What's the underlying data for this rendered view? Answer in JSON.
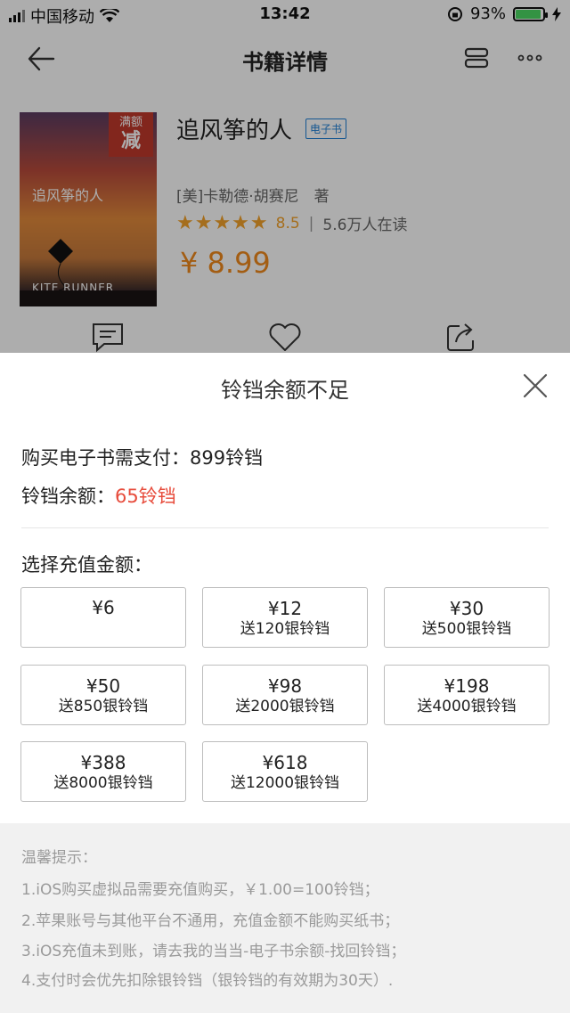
{
  "status_bar": {
    "carrier": "中国移动",
    "time": "13:42",
    "battery": "93%"
  },
  "nav": {
    "title": "书籍详情"
  },
  "book": {
    "title": "追风筝的人",
    "tag": "电子书",
    "author": "[美]卡勒德·胡赛尼　著",
    "rating": "8.5",
    "readers": "5.6万人在读",
    "price": "¥ 8.99",
    "cover": {
      "badge_top": "满额",
      "badge_big": "减",
      "cn_title": "追风筝的人",
      "en_title": "KITE RUNNER"
    }
  },
  "modal": {
    "title": "铃铛余额不足",
    "pay_label": "购买电子书需支付：",
    "pay_amount": "899铃铛",
    "balance_label": "铃铛余额：",
    "balance_amount": "65铃铛",
    "choose_label": "选择充值金额：",
    "options": [
      {
        "amount": "¥6",
        "bonus": ""
      },
      {
        "amount": "¥12",
        "bonus": "送120银铃铛"
      },
      {
        "amount": "¥30",
        "bonus": "送500银铃铛"
      },
      {
        "amount": "¥50",
        "bonus": "送850银铃铛"
      },
      {
        "amount": "¥98",
        "bonus": "送2000银铃铛"
      },
      {
        "amount": "¥198",
        "bonus": "送4000银铃铛"
      },
      {
        "amount": "¥388",
        "bonus": "送8000银铃铛"
      },
      {
        "amount": "¥618",
        "bonus": "送12000银铃铛"
      }
    ]
  },
  "tips": {
    "heading": "温馨提示：",
    "items": [
      "1.iOS购买虚拟品需要充值购买，￥1.00=100铃铛；",
      "2.苹果账号与其他平台不通用，充值金额不能购买纸书；",
      "3.iOS充值未到账，请去我的当当-电子书余额-找回铃铛；",
      "4.支付时会优先扣除银铃铛（银铃铛的有效期为30天）."
    ]
  },
  "colors": {
    "price_orange": "#f08a1c",
    "star_gold": "#f3a32b",
    "balance_red": "#e74c3c",
    "tag_blue": "#1e7fd6"
  }
}
